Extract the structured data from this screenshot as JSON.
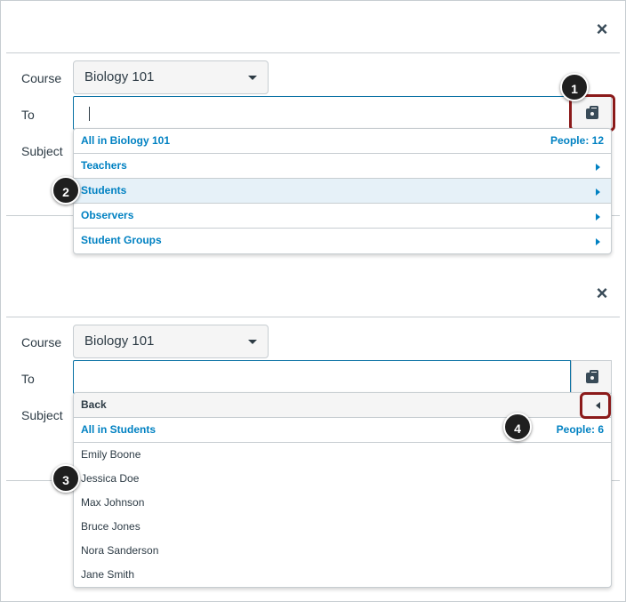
{
  "panels": [
    {
      "close_glyph": "×",
      "labels": {
        "course": "Course",
        "to": "To",
        "subject": "Subject"
      },
      "course_select": "Biology 101",
      "dropdown": {
        "header": {
          "label": "All in Biology 101",
          "count": "People: 12"
        },
        "items": [
          {
            "label": "Teachers"
          },
          {
            "label": "Students"
          },
          {
            "label": "Observers"
          },
          {
            "label": "Student Groups"
          }
        ]
      },
      "callouts": [
        "1",
        "2"
      ]
    },
    {
      "close_glyph": "×",
      "labels": {
        "course": "Course",
        "to": "To",
        "subject": "Subject"
      },
      "course_select": "Biology 101",
      "dropdown": {
        "back": "Back",
        "header": {
          "label": "All in Students",
          "count": "People: 6"
        },
        "students": [
          "Emily Boone",
          "Jessica Doe",
          "Max Johnson",
          "Bruce Jones",
          "Nora Sanderson",
          "Jane Smith"
        ]
      },
      "callouts": [
        "3",
        "4"
      ]
    }
  ],
  "colors": {
    "link": "#0081c2",
    "highlight_box": "#8b1a1a",
    "input_border": "#0770a3",
    "row_hover": "#e6f1f8"
  },
  "icons": {
    "close": "close-icon",
    "address_book": "address-book-icon",
    "submenu": "triangle-right-icon",
    "back": "triangle-left-icon",
    "dropdown": "chevron-down-icon"
  }
}
